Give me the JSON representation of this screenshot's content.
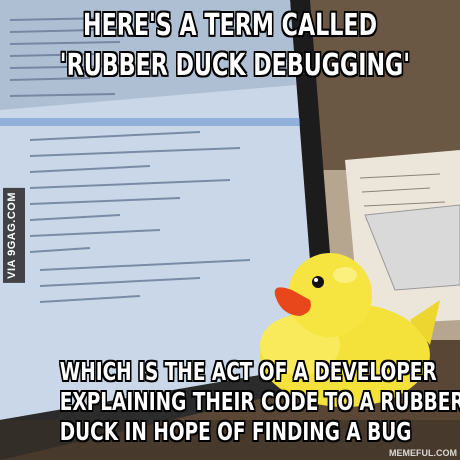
{
  "meme": {
    "top_line_1": "HERE'S A TERM CALLED",
    "top_line_2": "'RUBBER DUCK DEBUGGING'",
    "bottom_line_1": "WHICH IS THE ACT OF A DEVELOPER",
    "bottom_line_2": "EXPLAINING THEIR CODE TO A RUBBER",
    "bottom_line_3": "DUCK IN HOPE OF FINDING A BUG",
    "watermark": "VIA 9GAG.COM",
    "credit": "MEMEFUL.COM"
  },
  "photo": {
    "subject": "rubber-duck",
    "colors": {
      "duck": "#f4e13a",
      "beak": "#e8471b",
      "screen": "#c9d7e8",
      "desk": "#6b5844"
    }
  }
}
